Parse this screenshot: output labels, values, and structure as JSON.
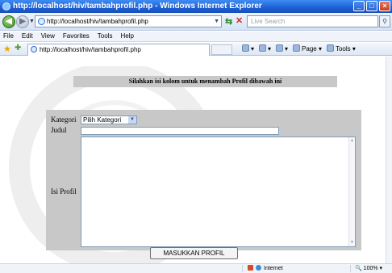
{
  "window": {
    "title": "http://localhost/hiv/tambahprofil.php - Windows Internet Explorer"
  },
  "addressbar": {
    "url": "http://localhost/hiv/tambahprofil.php",
    "search_placeholder": "Live Search"
  },
  "menu": [
    "File",
    "Edit",
    "View",
    "Favorites",
    "Tools",
    "Help"
  ],
  "tab": {
    "label": "http://localhost/hiv/tambahprofil.php"
  },
  "commands": {
    "page": "Page",
    "tools": "Tools"
  },
  "form": {
    "instruction": "Silahkan isi kolom untuk menambah Profil dibawah ini",
    "kategori_label": "Kategori",
    "kategori_selected": "Pilih Kategori",
    "judul_label": "Judul",
    "judul_value": "",
    "isi_label": "Isi Profil",
    "isi_value": "",
    "submit_label": "MASUKKAN PROFIL"
  },
  "status": {
    "zone": "Internet",
    "zoom": "100%"
  }
}
